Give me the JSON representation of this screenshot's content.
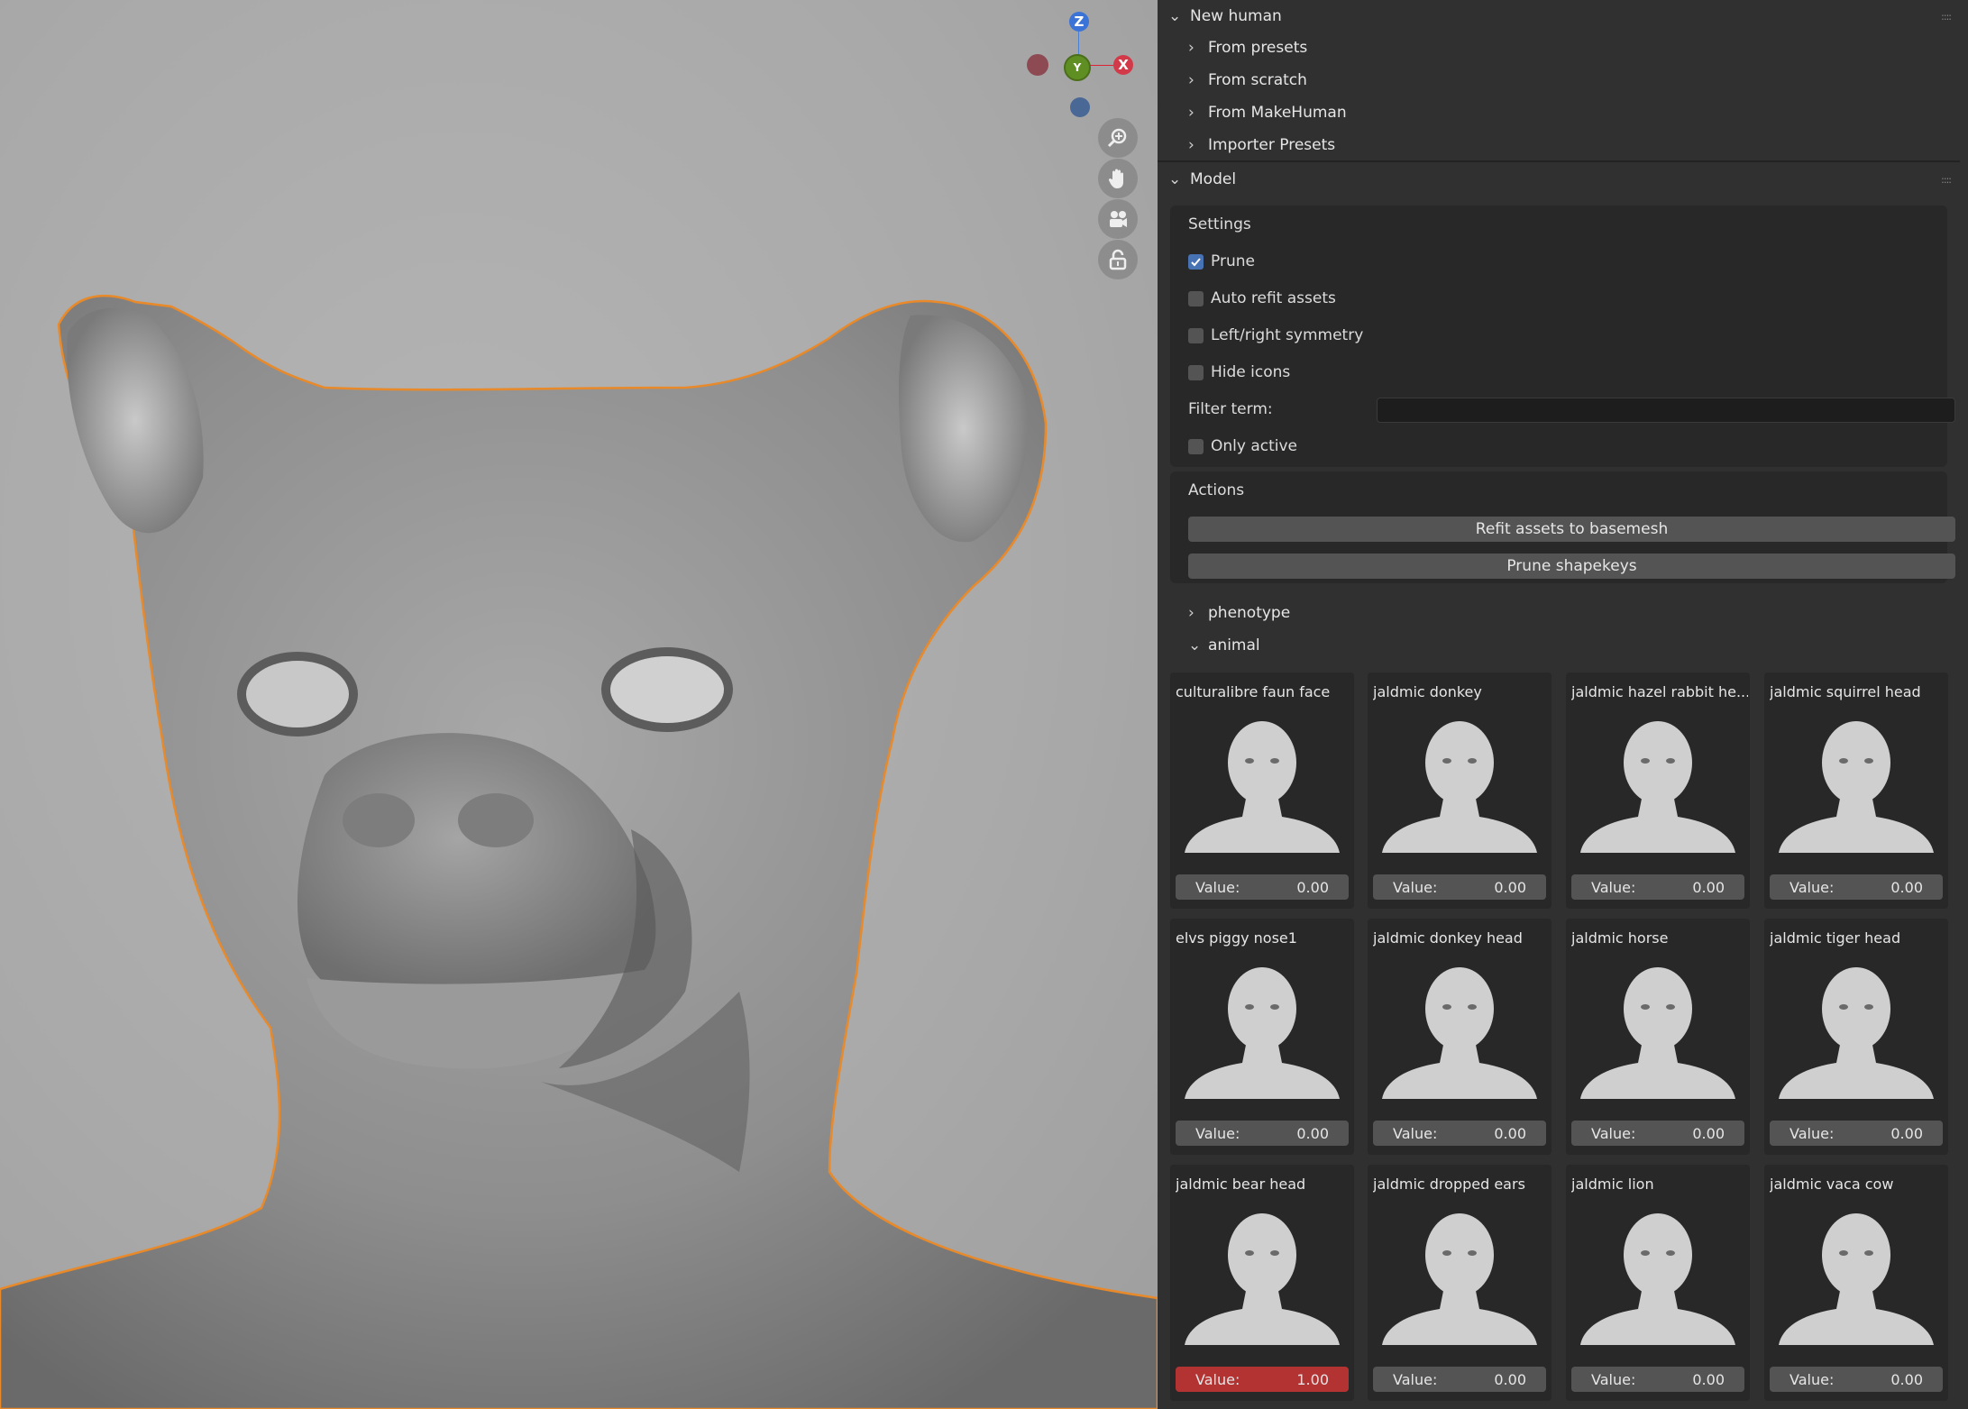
{
  "colors": {
    "accent": "#4772b3",
    "active_value": "#b33333",
    "selection_outline": "#e8892a"
  },
  "gizmo": {
    "z": "Z",
    "y": "Y",
    "x": "X"
  },
  "viewport_tools": [
    "zoom-icon",
    "hand-pan-icon",
    "camera-icon",
    "lock-icon"
  ],
  "new_human": {
    "label": "New human",
    "items": [
      {
        "label": "From presets"
      },
      {
        "label": "From scratch"
      },
      {
        "label": "From MakeHuman"
      },
      {
        "label": "Importer Presets"
      }
    ]
  },
  "model": {
    "label": "Model",
    "settings": {
      "title": "Settings",
      "prune": "Prune",
      "auto_refit": "Auto refit assets",
      "symmetry": "Left/right symmetry",
      "hide_icons": "Hide icons",
      "filter_label": "Filter term:",
      "filter_value": "",
      "only_active": "Only active",
      "checks": {
        "prune": true,
        "auto_refit": false,
        "symmetry": false,
        "hide_icons": false,
        "only_active": false
      }
    },
    "actions": {
      "title": "Actions",
      "refit": "Refit assets to basemesh",
      "prune_keys": "Prune shapekeys"
    },
    "phenotype": "phenotype",
    "animal": "animal"
  },
  "value_label": "Value:",
  "targets": [
    {
      "name": "culturalibre faun face",
      "value": "0.00"
    },
    {
      "name": "jaldmic donkey",
      "value": "0.00"
    },
    {
      "name": "jaldmic hazel rabbit he...",
      "value": "0.00"
    },
    {
      "name": "jaldmic squirrel head",
      "value": "0.00"
    },
    {
      "name": "elvs piggy nose1",
      "value": "0.00"
    },
    {
      "name": "jaldmic donkey head",
      "value": "0.00"
    },
    {
      "name": "jaldmic horse",
      "value": "0.00"
    },
    {
      "name": "jaldmic tiger head",
      "value": "0.00"
    },
    {
      "name": "jaldmic bear head",
      "value": "1.00"
    },
    {
      "name": "jaldmic dropped ears",
      "value": "0.00"
    },
    {
      "name": "jaldmic lion",
      "value": "0.00"
    },
    {
      "name": "jaldmic vaca cow",
      "value": "0.00"
    }
  ]
}
